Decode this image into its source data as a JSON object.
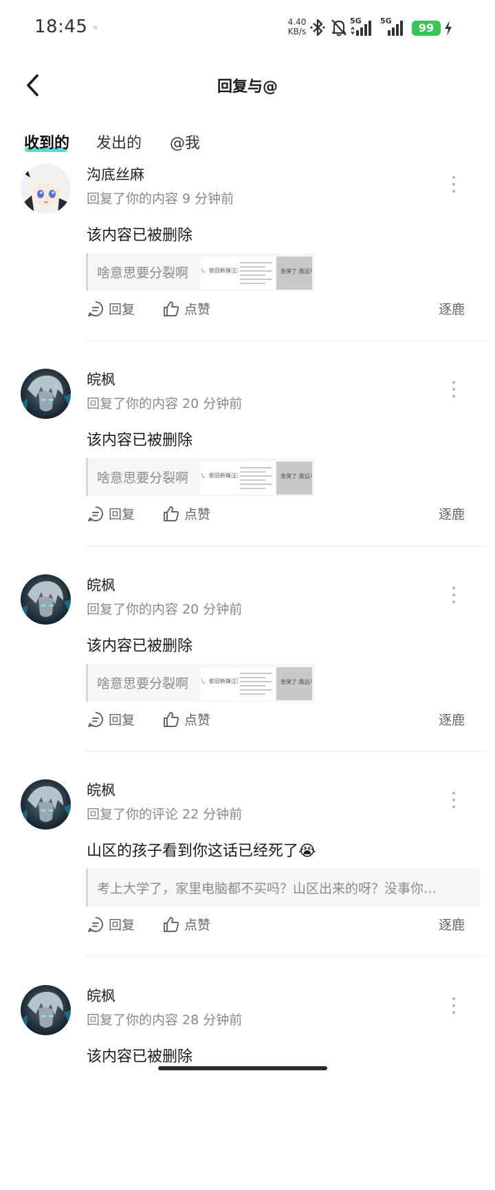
{
  "status_bar": {
    "time": "18:45",
    "net_speed_value": "4.40",
    "net_speed_unit": "KB/s",
    "sim1_label": "5G",
    "sim2_label": "5G",
    "battery": "99",
    "icons": [
      "bluetooth-icon",
      "mute-bell-icon",
      "signal-icon",
      "signal-icon",
      "battery-icon",
      "charging-icon"
    ]
  },
  "header": {
    "title": "回复与@",
    "back_icon": "chevron-left-icon"
  },
  "tabs": [
    {
      "label": "收到的",
      "active": true
    },
    {
      "label": "发出的",
      "active": false
    },
    {
      "label": "@我",
      "active": false
    }
  ],
  "actions": {
    "reply_label": "回复",
    "like_label": "点赞",
    "source_label": "逐鹿"
  },
  "notifications": [
    {
      "username": "沟底丝麻",
      "meta": "回复了你的内容 9 分钟前",
      "content": "该内容已被删除",
      "quote": "啥意思要分裂啊",
      "has_images": true,
      "thumb_captions": [
        "\\、依旧新锋汪洼",
        "急哭了:我远不"
      ]
    },
    {
      "username": "皖枫",
      "meta": "回复了你的内容 20 分钟前",
      "content": "该内容已被删除",
      "quote": "啥意思要分裂啊",
      "has_images": true,
      "thumb_captions": [
        "\\、依旧新锋汪洼",
        "急哭了:我远不"
      ]
    },
    {
      "username": "皖枫",
      "meta": "回复了你的内容 20 分钟前",
      "content": "该内容已被删除",
      "quote": "啥意思要分裂啊",
      "has_images": true,
      "thumb_captions": [
        "\\、依旧新锋汪洼",
        "急哭了:我远不"
      ]
    },
    {
      "username": "皖枫",
      "meta": "回复了你的评论 22 分钟前",
      "content": "山区的孩子看到你这话已经死了😭",
      "quote": "考上大学了，家里电脑都不买吗？山区出来的呀？没事你…",
      "has_images": false
    },
    {
      "username": "皖枫",
      "meta": "回复了你的内容 28 分钟前",
      "content": "该内容已被删除",
      "quote": "",
      "has_images": false
    }
  ],
  "colors": {
    "accent_teal": "#36c7c4",
    "battery_green": "#35c75a",
    "meta_gray": "#888888"
  }
}
